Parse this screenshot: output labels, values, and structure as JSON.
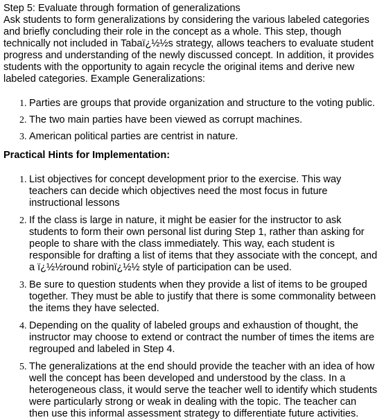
{
  "step5": {
    "heading": "Step 5: Evaluate through formation of generalizations",
    "body": "Ask students to form generalizations by considering the various labeled categories and briefly concluding their role in the concept as a whole. This step, though technically not included in Tabaï¿½½s strategy, allows teachers to evaluate student progress and understanding of the newly discussed concept. In addition, it provides students with the opportunity to again recycle the original items and derive new labeled categories. Example Generalizations:"
  },
  "examples": [
    "Parties are groups that provide organization and structure to the voting public.",
    "The two main parties have been viewed as corrupt machines.",
    "American political parties are centrist in nature."
  ],
  "hints": {
    "title": "Practical Hints for Implementation:",
    "items": [
      "List objectives for concept development prior to the exercise. This way teachers can decide which objectives need the most focus in future instructional lessons",
      "If the class is large in nature, it might be easier for the instructor to ask students to form their own personal list during Step 1, rather than asking for people to share with the class immediately. This way, each student is responsible for drafting a list of items that they associate with the concept, and a ï¿½½round robinï¿½½ style of participation can be used.",
      "Be sure to question students when they provide a list of items to be grouped together. They must be able to justify that there is some commonality between the items they have selected.",
      "Depending on the quality of labeled groups and exhaustion of thought, the instructor may choose to extend or contract the number of times the items are regrouped and labeled in Step 4.",
      "The generalizations at the end should provide the teacher with an idea of how well the concept has been developed and understood by the class. In a heterogeneous class, it would serve the teacher well to identify which students were particularly strong or weak in dealing with the topic. The teacher can then use this informal assessment strategy to differentiate future activities."
    ]
  }
}
